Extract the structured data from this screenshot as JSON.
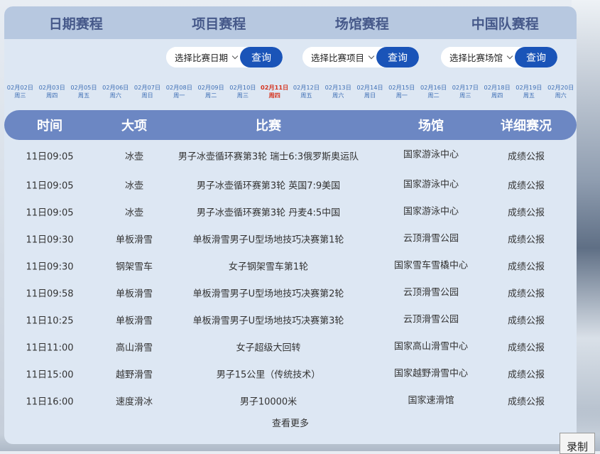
{
  "tabs": [
    "日期赛程",
    "项目赛程",
    "场馆赛程",
    "中国队赛程"
  ],
  "filters": [
    {
      "label": "选择比赛日期",
      "button": "查询"
    },
    {
      "label": "选择比赛项目",
      "button": "查询"
    },
    {
      "label": "选择比赛场馆",
      "button": "查询"
    }
  ],
  "dates": [
    {
      "date": "02月02日",
      "weekday": "周三"
    },
    {
      "date": "02月03日",
      "weekday": "周四"
    },
    {
      "date": "02月05日",
      "weekday": "周五"
    },
    {
      "date": "02月06日",
      "weekday": "周六"
    },
    {
      "date": "02月07日",
      "weekday": "周日"
    },
    {
      "date": "02月08日",
      "weekday": "周一"
    },
    {
      "date": "02月09日",
      "weekday": "周二"
    },
    {
      "date": "02月10日",
      "weekday": "周三"
    },
    {
      "date": "02月11日",
      "weekday": "周四"
    },
    {
      "date": "02月12日",
      "weekday": "周五"
    },
    {
      "date": "02月13日",
      "weekday": "周六"
    },
    {
      "date": "02月14日",
      "weekday": "周日"
    },
    {
      "date": "02月15日",
      "weekday": "周一"
    },
    {
      "date": "02月16日",
      "weekday": "周二"
    },
    {
      "date": "02月17日",
      "weekday": "周三"
    },
    {
      "date": "02月18日",
      "weekday": "周四"
    },
    {
      "date": "02月19日",
      "weekday": "周五"
    },
    {
      "date": "02月20日",
      "weekday": "周六"
    }
  ],
  "active_date_index": 8,
  "active_color": "#d6341f",
  "table": {
    "headers": [
      "时间",
      "大项",
      "比赛",
      "场馆",
      "详细赛况"
    ],
    "rows": [
      [
        "11日09:05",
        "冰壶",
        "男子冰壶循环赛第3轮 瑞士6:3俄罗斯奥运队",
        "国家游泳中心",
        "成绩公报"
      ],
      [
        "11日09:05",
        "冰壶",
        "男子冰壶循环赛第3轮 英国7:9美国",
        "国家游泳中心",
        "成绩公报"
      ],
      [
        "11日09:05",
        "冰壶",
        "男子冰壶循环赛第3轮 丹麦4:5中国",
        "国家游泳中心",
        "成绩公报"
      ],
      [
        "11日09:30",
        "单板滑雪",
        "单板滑雪男子U型场地技巧决赛第1轮",
        "云顶滑雪公园",
        "成绩公报"
      ],
      [
        "11日09:30",
        "钢架雪车",
        "女子钢架雪车第1轮",
        "国家雪车雪橇中心",
        "成绩公报"
      ],
      [
        "11日09:58",
        "单板滑雪",
        "单板滑雪男子U型场地技巧决赛第2轮",
        "云顶滑雪公园",
        "成绩公报"
      ],
      [
        "11日10:25",
        "单板滑雪",
        "单板滑雪男子U型场地技巧决赛第3轮",
        "云顶滑雪公园",
        "成绩公报"
      ],
      [
        "11日11:00",
        "高山滑雪",
        "女子超级大回转",
        "国家高山滑雪中心",
        "成绩公报"
      ],
      [
        "11日15:00",
        "越野滑雪",
        "男子15公里（传统技术）",
        "国家越野滑雪中心",
        "成绩公报"
      ],
      [
        "11日16:00",
        "速度滑冰",
        "男子10000米",
        "国家速滑馆",
        "成绩公报"
      ]
    ]
  },
  "more_label": "查看更多",
  "record_label": "录制"
}
